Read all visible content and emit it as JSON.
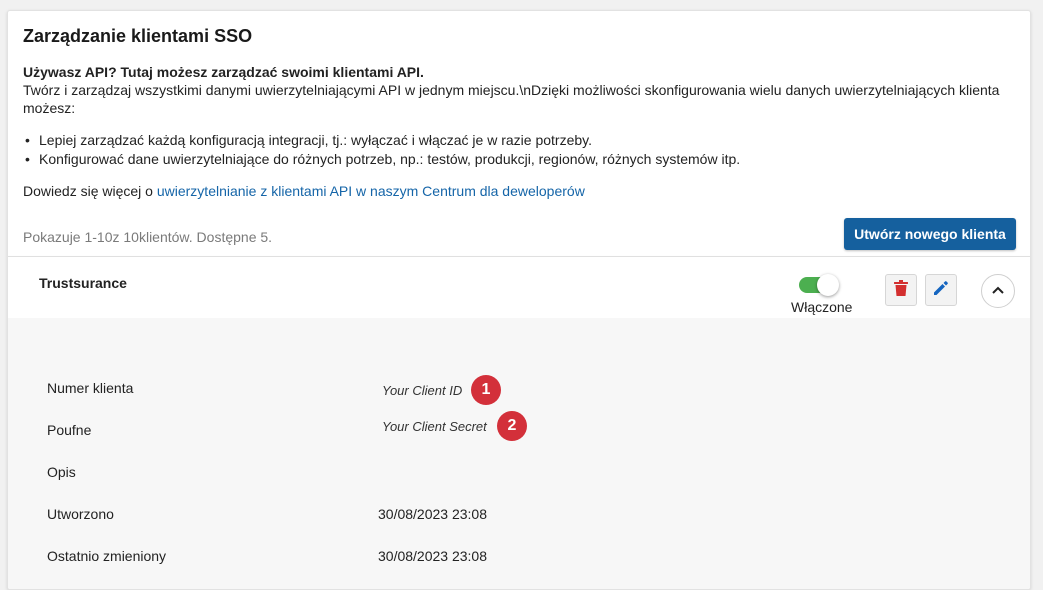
{
  "page": {
    "title": "Zarządzanie klientami SSO",
    "intro_bold": "Używasz API? Tutaj możesz zarządzać swoimi klientami API.",
    "intro_text": "Twórz i zarządzaj wszystkimi danymi uwierzytelniającymi API w jednym miejscu.\\nDzięki możliwości skonfigurowania wielu danych uwierzytelniających klienta możesz:",
    "bullets": [
      "Lepiej zarządzać każdą konfiguracją integracji, tj.: wyłączać i włączać je w razie potrzeby.",
      "Konfigurować dane uwierzytelniające do różnych potrzeb, np.: testów, produkcji, regionów, różnych systemów itp."
    ],
    "more_prefix": "Dowiedz się więcej o ",
    "more_link": "uwierzytelnianie z klientami API w naszym Centrum dla deweloperów",
    "count_text": "Pokazuje 1-10z 10klientów. Dostępne 5.",
    "create_button": "Utwórz nowego klienta"
  },
  "client": {
    "name": "Trustsurance",
    "toggle_label": "Włączone",
    "toggle_on": true,
    "toggle_color": "#4caf50",
    "delete_icon": "trash-icon",
    "edit_icon": "pencil-icon",
    "collapse_icon": "chevron-up-icon"
  },
  "details": {
    "client_id_label": "Numer klienta",
    "client_id_value": "Your Client ID",
    "secret_label": "Poufne",
    "secret_value": "Your Client Secret",
    "description_label": "Opis",
    "description_value": "",
    "created_label": "Utworzono",
    "created_value": "30/08/2023 23:08",
    "modified_label": "Ostatnio zmieniony",
    "modified_value": "30/08/2023 23:08"
  },
  "annotations": {
    "badge_1": "1",
    "badge_2": "2",
    "badge_color": "#d3303a"
  }
}
